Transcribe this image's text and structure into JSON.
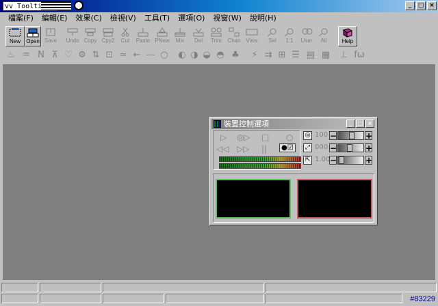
{
  "window": {
    "logo_text": "vv Tooltip",
    "controls": {
      "minimize": "_",
      "maximize": "□",
      "close": "×"
    }
  },
  "menu": [
    "檔案(F)",
    "編輯(E)",
    "效果(C)",
    "檢視(V)",
    "工具(T)",
    "選項(O)",
    "視窗(W)",
    "說明(H)"
  ],
  "toolbar": [
    {
      "label": "New",
      "enabled": true
    },
    {
      "label": "Open",
      "enabled": true
    },
    {
      "label": "Save",
      "enabled": false
    },
    {
      "label": "Undo",
      "enabled": false
    },
    {
      "label": "Copy",
      "enabled": false
    },
    {
      "label": "Cpy2",
      "enabled": false
    },
    {
      "label": "Cut",
      "enabled": false
    },
    {
      "label": "Paste",
      "enabled": false
    },
    {
      "label": "PNew",
      "enabled": false
    },
    {
      "label": "Mix",
      "enabled": false
    },
    {
      "label": "Del",
      "enabled": false
    },
    {
      "label": "Trim",
      "enabled": false
    },
    {
      "label": "Chan",
      "enabled": false
    },
    {
      "label": "View",
      "enabled": false
    },
    {
      "label": "Sel",
      "enabled": false
    },
    {
      "label": "1:1",
      "enabled": false
    },
    {
      "label": "User",
      "enabled": false
    },
    {
      "label": "All",
      "enabled": false
    },
    {
      "label": "Help",
      "enabled": true
    }
  ],
  "toolbar2_glyphs": [
    "♨",
    "♒",
    "N",
    "⊼",
    "♡",
    "⚙",
    "⇅",
    "⊡",
    "≃",
    "←",
    "—",
    "○",
    "◐",
    "◑",
    "◒",
    "◓",
    "♣",
    "⚡",
    "⇉",
    "⊞",
    "☰",
    "▤",
    "▦",
    "⊥",
    "fω"
  ],
  "device_dialog": {
    "title": "裝置控制選項",
    "transport": {
      "row1": [
        "▷",
        "◎▷",
        "□",
        "○"
      ],
      "row2": [
        "◁◁",
        "▷▷",
        "||",
        "●☑"
      ]
    },
    "sliders": [
      {
        "icon": "◎",
        "value_text": "100",
        "level": 0.55
      },
      {
        "icon": "⤢",
        "value_text": "000",
        "level": 0.45
      },
      {
        "icon": "⇱",
        "value_text": "1.00",
        "level": 0.05
      }
    ],
    "preview_colors": {
      "left": "#60c060",
      "right": "#c06060"
    }
  },
  "status": {
    "tag": "#83229"
  }
}
